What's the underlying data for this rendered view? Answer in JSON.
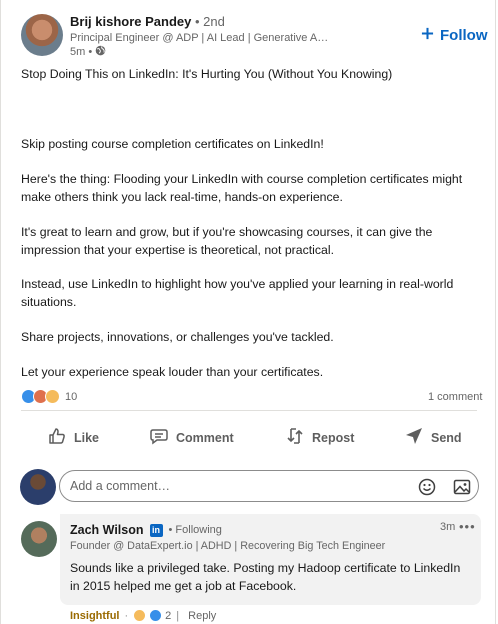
{
  "post": {
    "author_name": "Brij kishore Pandey",
    "author_degree": " • 2nd",
    "author_headline": "Principal Engineer @ ADP | AI Lead | Generative AI St...",
    "time": "5m •",
    "follow_label": "Follow",
    "paragraphs": [
      "Stop Doing This on LinkedIn: It's Hurting You (Without You Knowing)",
      "Skip posting course completion certificates on LinkedIn!",
      "Here's the thing: Flooding your LinkedIn with course completion certificates might make others think you lack real-time, hands-on experience.",
      "It's great to learn and grow, but if you're showcasing courses, it can give the impression that your expertise is theoretical, not practical.",
      "Instead, use LinkedIn to highlight how you've applied your learning in real-world situations.",
      "Share projects, innovations, or challenges you've tackled.",
      "Let your experience speak louder than your certificates."
    ],
    "reaction_count": "10",
    "comment_count": "1 comment"
  },
  "actions": {
    "like": "Like",
    "comment": "Comment",
    "repost": "Repost",
    "send": "Send"
  },
  "composer": {
    "placeholder": "Add a comment…"
  },
  "comment": {
    "author_name": "Zach Wilson",
    "badge": "in",
    "following": "• Following",
    "time": "3m",
    "more": "•••",
    "headline": "Founder @ DataExpert.io | ADHD | Recovering Big Tech Engineer",
    "text": "Sounds like a privileged take. Posting my Hadoop certificate to LinkedIn in 2015 helped me get a job at Facebook.",
    "reaction_label": "Insightful",
    "dot": "·",
    "reaction_count": "2",
    "sep": "|",
    "reply_label": "Reply"
  },
  "colors": {
    "accent": "#0a66c2",
    "like": "#378fe9",
    "love": "#df704d",
    "insightful": "#f5bb5c"
  },
  "icons": [
    "globe-icon",
    "plus-icon",
    "like-icon",
    "comment-icon",
    "repost-icon",
    "send-icon",
    "emoji-icon",
    "image-icon",
    "linkedin-icon"
  ]
}
